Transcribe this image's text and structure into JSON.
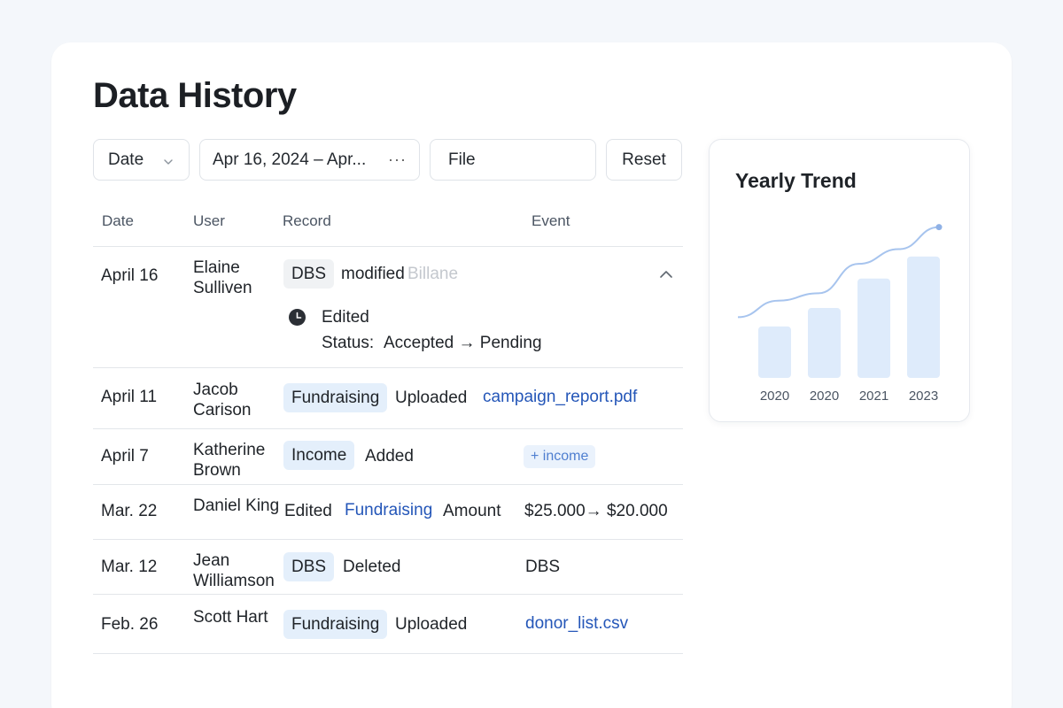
{
  "page": {
    "title": "Data History"
  },
  "filters": {
    "date_label": "Date",
    "range_value": "Apr 16, 2024 – Apr...",
    "range_more": "···",
    "file_label": "File",
    "reset_label": "Reset"
  },
  "table": {
    "headers": [
      "Date",
      "User",
      "Record",
      "Event"
    ],
    "rows": [
      {
        "date": "April 16",
        "user": "Elaine Sulliven",
        "tag": "DBS",
        "action": "modified",
        "faint": "Billane",
        "detail_event": "Edited",
        "detail_status_label": "Status:",
        "detail_status_change": "Accepted → Pending"
      },
      {
        "date": "April 11",
        "user": "Jacob Carison",
        "tag": "Fundraising",
        "action": "Uploaded",
        "target": "campaign_report.pdf"
      },
      {
        "date": "April 7",
        "user": "Katherine Brown",
        "tag": "Income",
        "action": "Added",
        "chip": "+ income"
      },
      {
        "date": "Mar. 22",
        "user": "Daniel King",
        "action": "Edited",
        "link": "Fundraising",
        "field": "Amount",
        "change": "$25.000→ $20.000"
      },
      {
        "date": "Mar. 12",
        "user": "Jean Williamson",
        "tag": "DBS",
        "action": "Deleted",
        "target": "DBS"
      },
      {
        "date": "Feb. 26",
        "user": "Scott Hart",
        "tag": "Fundraising",
        "action": "Uploaded",
        "target": "donor_list.csv"
      }
    ]
  },
  "trend": {
    "title": "Yearly Trend"
  },
  "chart_data": {
    "type": "bar",
    "title": "Yearly Trend",
    "categories": [
      "2020",
      "2020",
      "2021",
      "2023"
    ],
    "values": [
      28,
      38,
      54,
      66
    ],
    "line": [
      33,
      42,
      46,
      62,
      70,
      82
    ],
    "ylim": [
      0,
      90
    ],
    "bar_color": "#deebfb",
    "line_color": "#a7c4ee"
  }
}
